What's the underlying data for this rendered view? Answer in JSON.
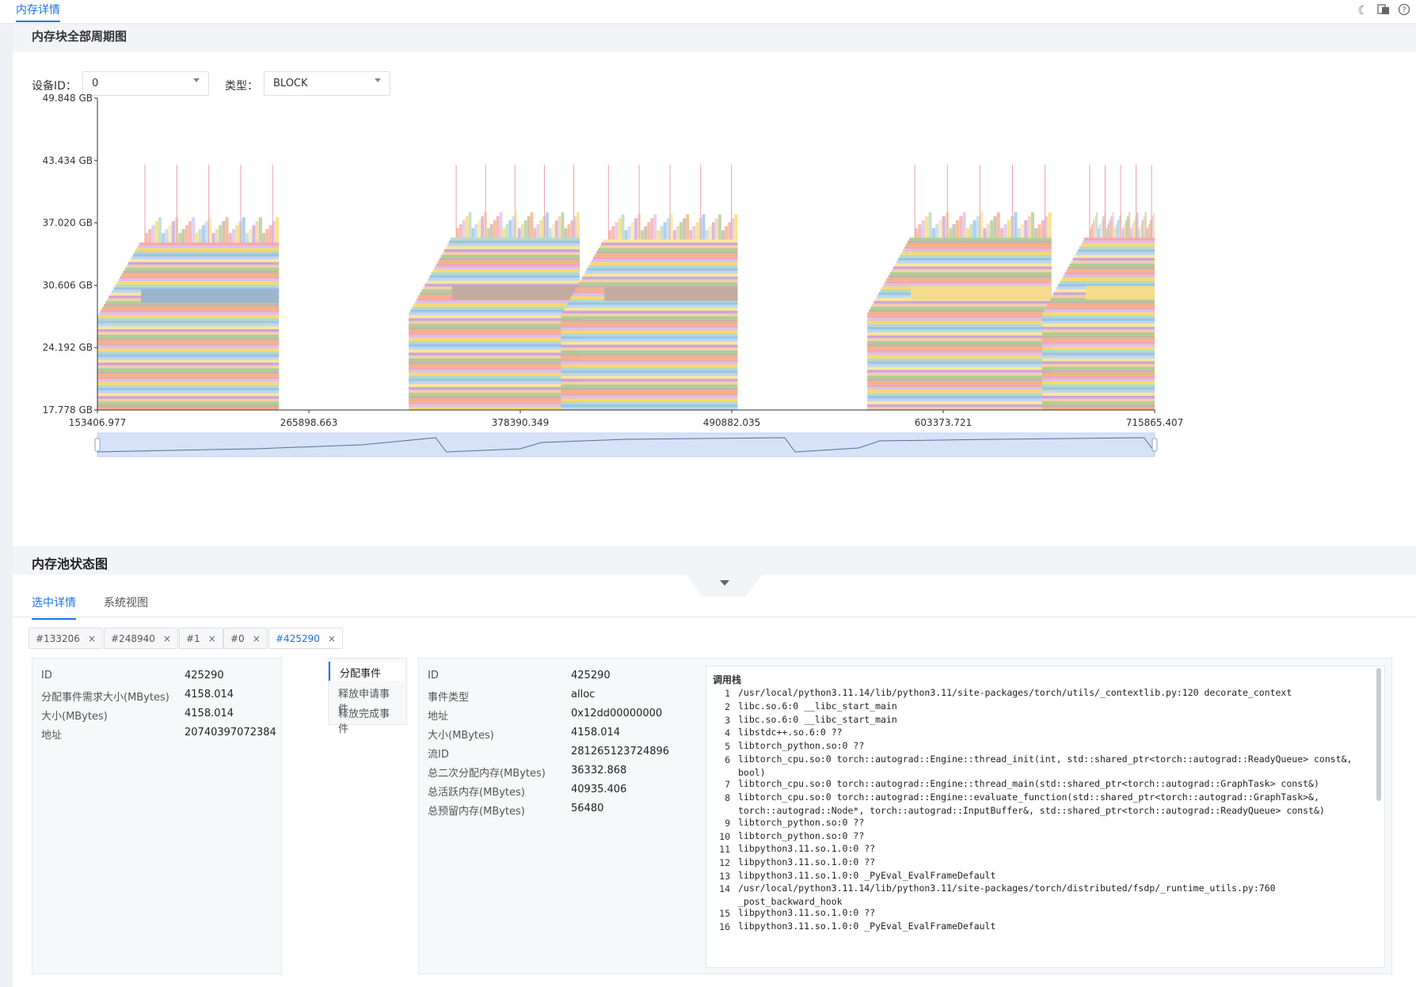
{
  "topbar": {
    "active_tab": "内存详情",
    "icons": [
      "moon-icon",
      "translate-icon",
      "help-icon"
    ]
  },
  "lifecycle": {
    "title": "内存块全部周期图",
    "device_label": "设备ID：",
    "device_value": "0",
    "type_label": "类型：",
    "type_value": "BLOCK"
  },
  "chart_data": {
    "type": "area",
    "y_ticks": [
      "49.848 GB",
      "43.434 GB",
      "37.020 GB",
      "30.606 GB",
      "24.192 GB",
      "17.778 GB"
    ],
    "x_ticks": [
      "153406.977",
      "265898.663",
      "378390.349",
      "490882.035",
      "603373.721",
      "715865.407"
    ],
    "ylim": [
      17.778,
      49.848
    ],
    "xlim": [
      153406.977,
      715865.407
    ],
    "segments": [
      {
        "x0": 153406.977,
        "x1": 250000,
        "base": 17.778,
        "top": 35.0
      },
      {
        "x0": 319000,
        "x1": 410000,
        "base": 17.778,
        "top": 35.5
      },
      {
        "x0": 400000,
        "x1": 494000,
        "base": 17.778,
        "top": 35.3
      },
      {
        "x0": 563000,
        "x1": 661000,
        "base": 17.778,
        "top": 35.5
      },
      {
        "x0": 656000,
        "x1": 715865.407,
        "base": 17.778,
        "top": 35.5
      }
    ],
    "colors": [
      "#f4b183",
      "#9dc3e6",
      "#a9d18e",
      "#ffd966",
      "#c9a7d8",
      "#f4a7b0",
      "#bdd7ee",
      "#c5b4a8",
      "#b4d9c8",
      "#f8cbad",
      "#d9c3e8",
      "#ffe699"
    ],
    "highlight_blocks": [
      "#9db3d0",
      "#c3aba0",
      "#f5dc8c"
    ],
    "grid": false,
    "minimap": true
  },
  "pool": {
    "title": "内存池状态图",
    "tabs": [
      "选中详情",
      "系统视图"
    ],
    "chips": [
      "#133206",
      "#248940",
      "#1",
      "#0",
      "#425290"
    ]
  },
  "block_details": [
    {
      "k": "ID",
      "v": "425290"
    },
    {
      "k": "分配事件需求大小(MBytes)",
      "v": "4158.014"
    },
    {
      "k": "大小(MBytes)",
      "v": "4158.014"
    },
    {
      "k": "地址",
      "v": "20740397072384"
    }
  ],
  "events": [
    "分配事件",
    "释放申请事件",
    "释放完成事件"
  ],
  "event_details": [
    {
      "k": "ID",
      "v": "425290"
    },
    {
      "k": "事件类型",
      "v": "alloc"
    },
    {
      "k": "地址",
      "v": "0x12dd00000000"
    },
    {
      "k": "大小(MBytes)",
      "v": "4158.014"
    },
    {
      "k": "流ID",
      "v": "281265123724896"
    },
    {
      "k": "总二次分配内存(MBytes)",
      "v": "36332.868"
    },
    {
      "k": "总活跃内存(MBytes)",
      "v": "40935.406"
    },
    {
      "k": "总预留内存(MBytes)",
      "v": "56480"
    }
  ],
  "callstack": {
    "title": "调用栈",
    "lines": [
      {
        "n": "1",
        "t": "/usr/local/python3.11.14/lib/python3.11/site-packages/torch/utils/_contextlib.py:120 decorate_context"
      },
      {
        "n": "2",
        "t": "libc.so.6:0 __libc_start_main"
      },
      {
        "n": "3",
        "t": "libc.so.6:0 __libc_start_main"
      },
      {
        "n": "4",
        "t": "libstdc++.so.6:0 ??"
      },
      {
        "n": "5",
        "t": "libtorch_python.so:0 ??"
      },
      {
        "n": "6",
        "t": "libtorch_cpu.so:0 torch::autograd::Engine::thread_init(int, std::shared_ptr<torch::autograd::ReadyQueue> const&, bool)"
      },
      {
        "n": "7",
        "t": "libtorch_cpu.so:0 torch::autograd::Engine::thread_main(std::shared_ptr<torch::autograd::GraphTask> const&)"
      },
      {
        "n": "8",
        "t": "libtorch_cpu.so:0 torch::autograd::Engine::evaluate_function(std::shared_ptr<torch::autograd::GraphTask>&, torch::autograd::Node*, torch::autograd::InputBuffer&, std::shared_ptr<torch::autograd::ReadyQueue> const&)"
      },
      {
        "n": "9",
        "t": "libtorch_python.so:0 ??"
      },
      {
        "n": "10",
        "t": "libtorch_python.so:0 ??"
      },
      {
        "n": "11",
        "t": "libpython3.11.so.1.0:0 ??"
      },
      {
        "n": "12",
        "t": "libpython3.11.so.1.0:0 ??"
      },
      {
        "n": "13",
        "t": "libpython3.11.so.1.0:0 _PyEval_EvalFrameDefault"
      },
      {
        "n": "14",
        "t": "/usr/local/python3.11.14/lib/python3.11/site-packages/torch/distributed/fsdp/_runtime_utils.py:760 _post_backward_hook"
      },
      {
        "n": "15",
        "t": "libpython3.11.so.1.0:0 ??"
      },
      {
        "n": "16",
        "t": "libpython3.11.so.1.0:0 _PyEval_EvalFrameDefault"
      }
    ]
  }
}
